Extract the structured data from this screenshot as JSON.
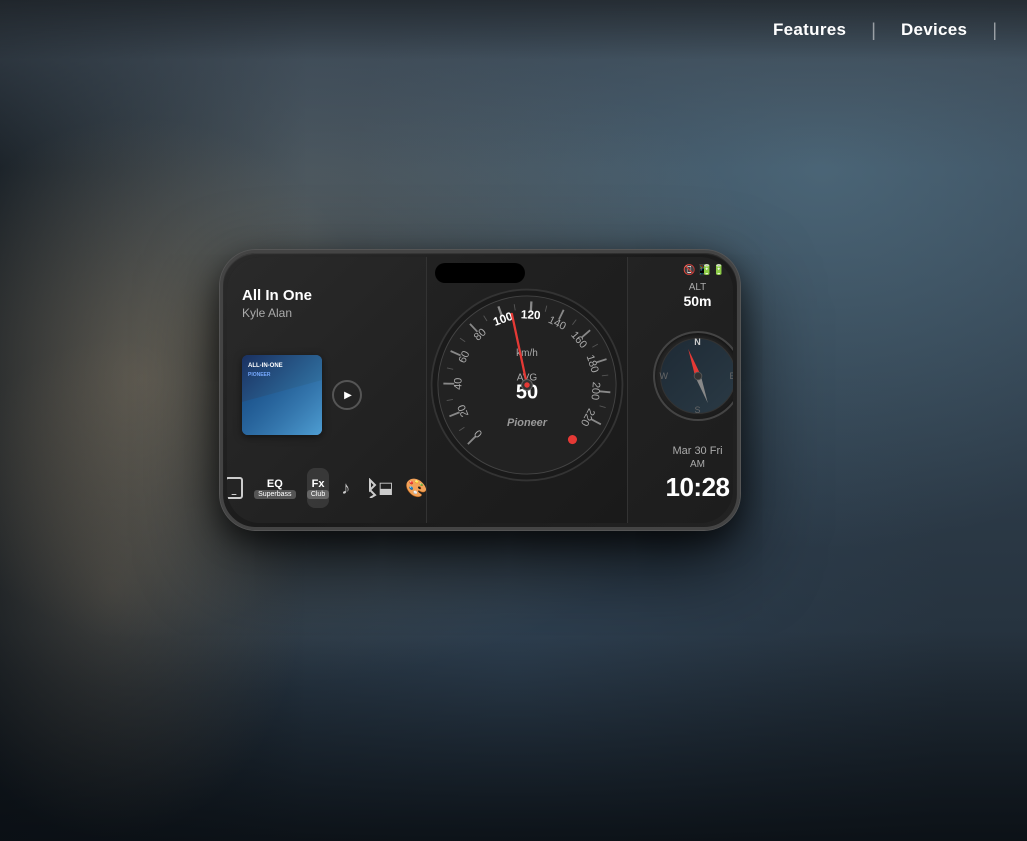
{
  "navbar": {
    "features_label": "Features",
    "devices_label": "Devices"
  },
  "phone": {
    "status": {
      "battery_icon": "🔋",
      "phone_icon": "📱"
    },
    "music": {
      "title": "All In One",
      "artist": "Kyle Alan",
      "album_line1": "ALL-IN-ONE",
      "album_line2": "PIONEER"
    },
    "speedometer": {
      "speed_unit": "km/h",
      "avg_label": "AVG",
      "avg_value": "50",
      "brand": "Pioneer",
      "max_speed": "220",
      "ticks": [
        "0",
        "20",
        "40",
        "60",
        "80",
        "100",
        "120",
        "140",
        "160",
        "180",
        "200",
        "220"
      ]
    },
    "altitude": {
      "label": "ALT",
      "value": "50m"
    },
    "compass": {
      "n": "N",
      "s": "S",
      "e": "E",
      "w": "W"
    },
    "datetime": {
      "date": "Mar 30 Fri",
      "period": "AM",
      "time": "10:28"
    },
    "bottom_bar": {
      "eq_label": "EQ",
      "eq_preset": "Superbass",
      "fx_label": "Fx",
      "fx_preset": "Club"
    }
  }
}
